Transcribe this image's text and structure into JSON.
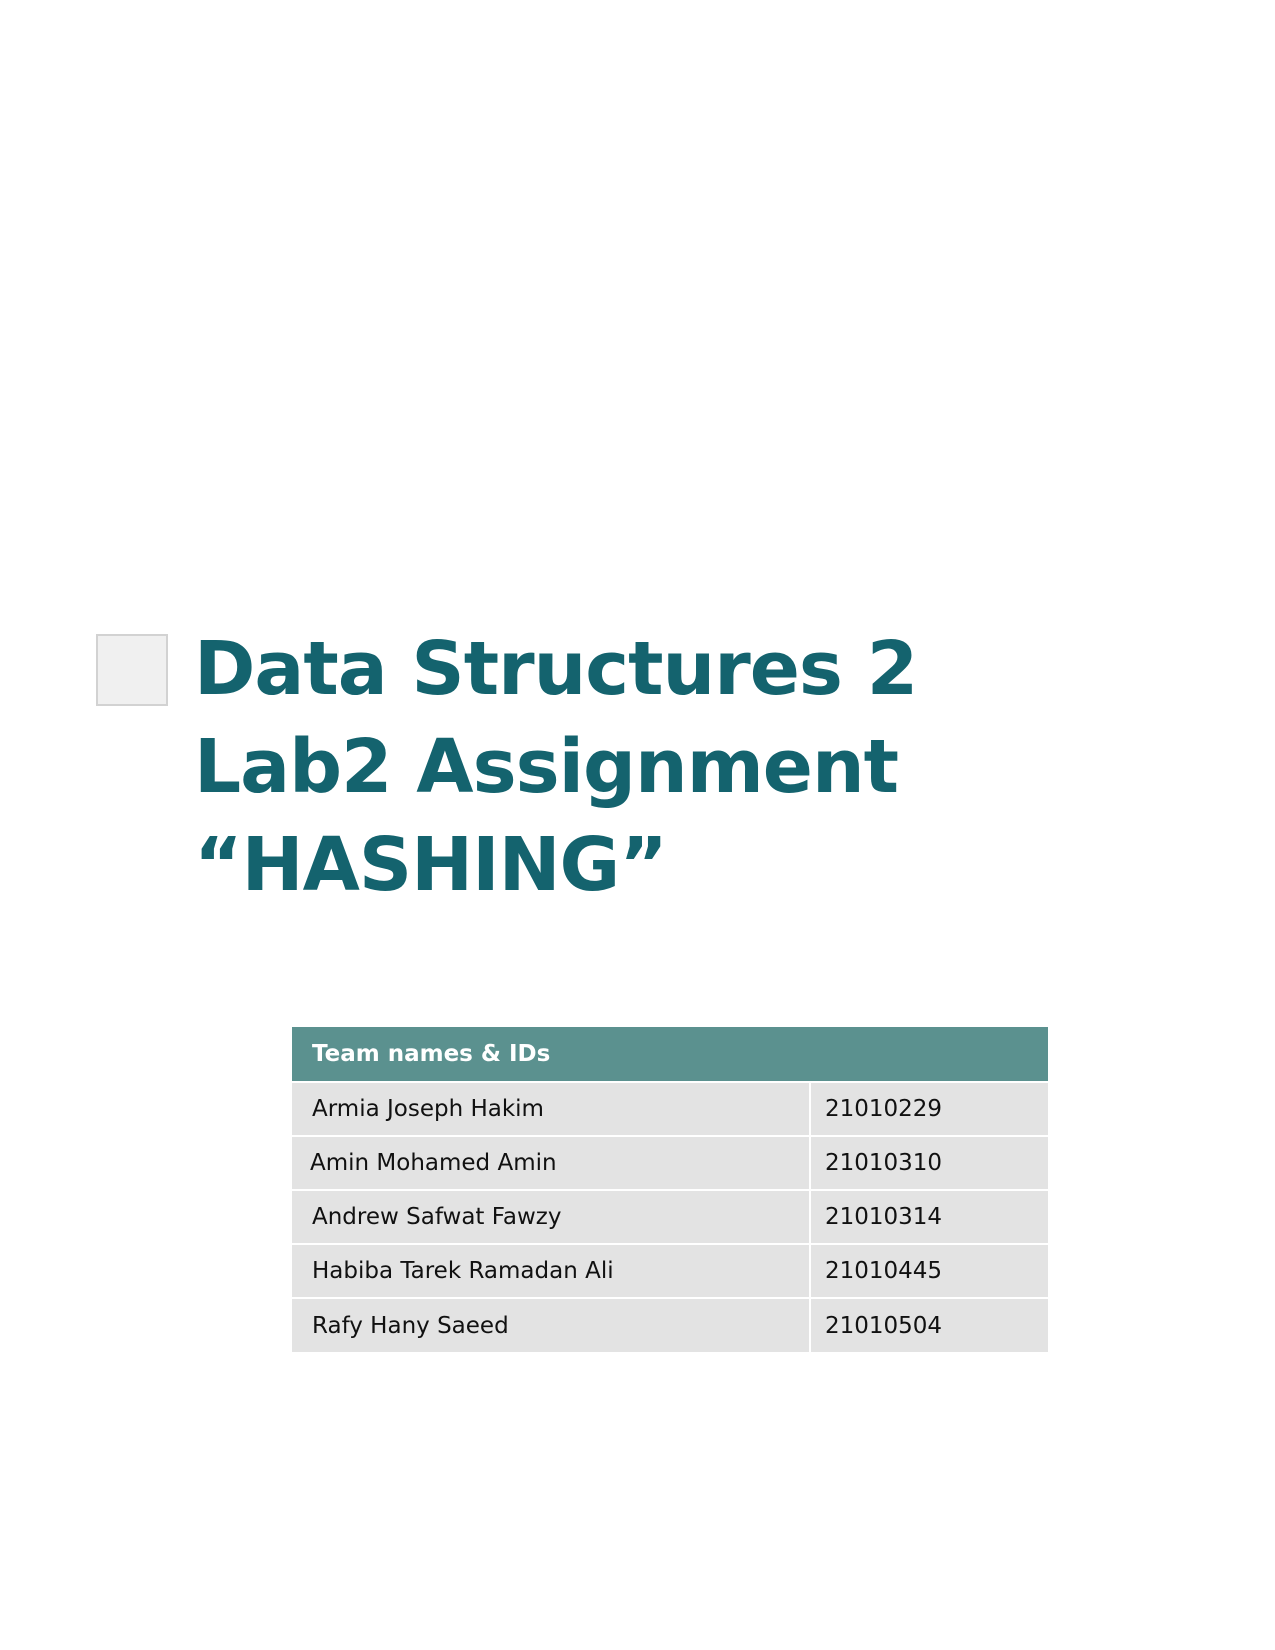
{
  "title": {
    "lines": [
      "Data Structures 2",
      "Lab2 Assignment",
      "“HASHING”"
    ]
  },
  "team_table": {
    "header": "Team names & IDs",
    "rows": [
      {
        "name": "Armia Joseph Hakim",
        "id": "21010229"
      },
      {
        "name": "Amin Mohamed Amin",
        "id": "21010310"
      },
      {
        "name": "Andrew Safwat Fawzy",
        "id": "21010314"
      },
      {
        "name": "Habiba Tarek Ramadan Ali",
        "id": "21010445"
      },
      {
        "name": "Rafy Hany Saeed",
        "id": "21010504"
      }
    ]
  },
  "colors": {
    "title": "#14636e",
    "table_header": "#5b918f",
    "table_row": "#e3e3e3"
  }
}
